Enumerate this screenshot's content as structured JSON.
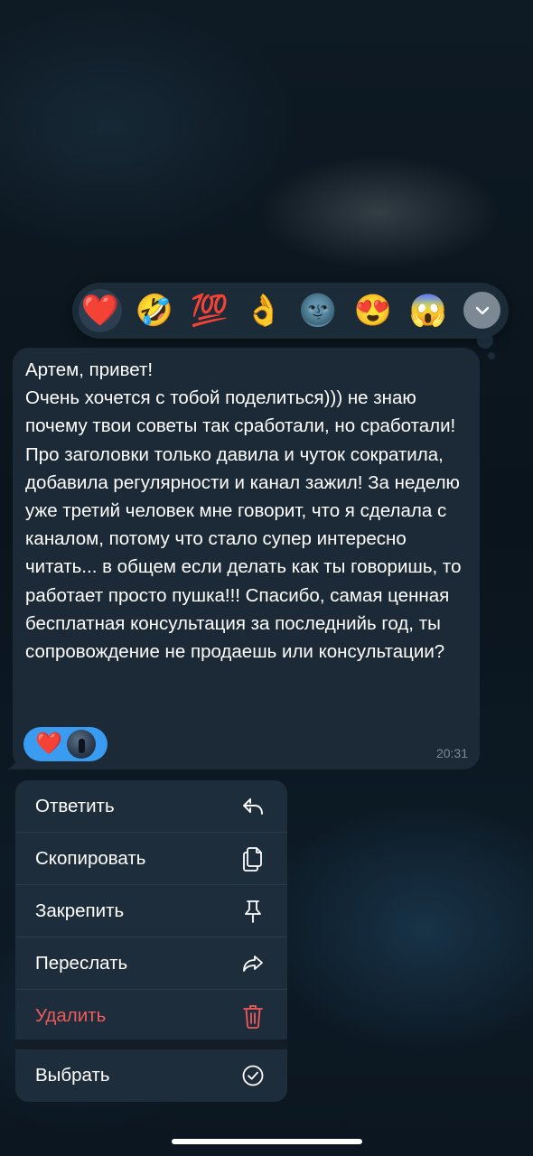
{
  "reactions": {
    "items": [
      {
        "emoji": "❤️",
        "name": "heart",
        "selected": true
      },
      {
        "emoji": "🤣",
        "name": "rofl"
      },
      {
        "emoji": "💯",
        "name": "hundred"
      },
      {
        "emoji": "👌",
        "name": "ok-hand"
      },
      {
        "emoji": "🌚",
        "name": "new-moon-face"
      },
      {
        "emoji": "😍",
        "name": "heart-eyes"
      },
      {
        "emoji": "😱",
        "name": "scream"
      }
    ],
    "expand_icon": "chevron-down-icon"
  },
  "message": {
    "text": "Артем, привет!\nОчень хочется с тобой поделиться))) не знаю почему твои советы так сработали, но сработали! Про заголовки только давила и чуток сократила, добавила регулярности и канал зажил! За неделю уже третий человек мне говорит, что я сделала с каналом, потому что стало супер интересно читать... в общем если делать как ты говоришь, то работает просто пушка!!! Спасибо, самая ценная бесплатная консультация за последнийь год, ты сопровождение не продаешь или консультации?",
    "reaction": "❤️",
    "time": "20:31"
  },
  "menu": {
    "items": [
      {
        "label": "Ответить",
        "icon": "reply-icon"
      },
      {
        "label": "Скопировать",
        "icon": "copy-icon"
      },
      {
        "label": "Закрепить",
        "icon": "pin-icon"
      },
      {
        "label": "Переслать",
        "icon": "forward-icon"
      },
      {
        "label": "Удалить",
        "icon": "trash-icon",
        "danger": true
      },
      {
        "label": "Выбрать",
        "icon": "check-circle-icon"
      }
    ]
  },
  "colors": {
    "accent": "#3a9cf0",
    "danger": "#ef5b5b",
    "bubble": "#1c2a38",
    "menu": "#1e2d3c"
  }
}
